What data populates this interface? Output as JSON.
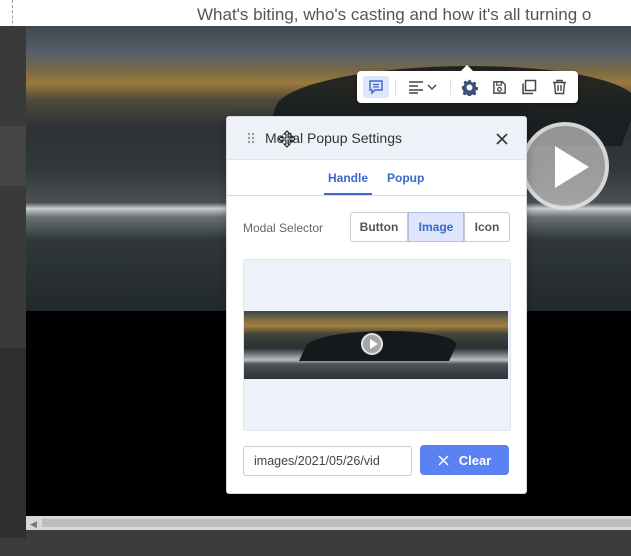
{
  "page": {
    "top_text": "What's biting, who's casting and how it's all turning o"
  },
  "toolbar": {
    "icons": [
      "comment-icon",
      "align-left-icon",
      "chevron-down-icon",
      "gear-icon",
      "save-icon",
      "copy-icon",
      "trash-icon"
    ],
    "accent": "#3a69c8"
  },
  "modal": {
    "title": "Modal Popup Settings",
    "tabs": [
      {
        "label": "Handle",
        "active": true
      },
      {
        "label": "Popup",
        "active": false
      }
    ],
    "selector_label": "Modal Selector",
    "selector_options": [
      "Button",
      "Image",
      "Icon"
    ],
    "selected_option": "Image",
    "image_path": "images/2021/05/26/vid",
    "clear_label": "Clear"
  },
  "colors": {
    "accent": "#3a69c8",
    "button": "#5a82f2",
    "selected_bg": "#dfe6fb",
    "header_bg": "#eef2f8"
  }
}
